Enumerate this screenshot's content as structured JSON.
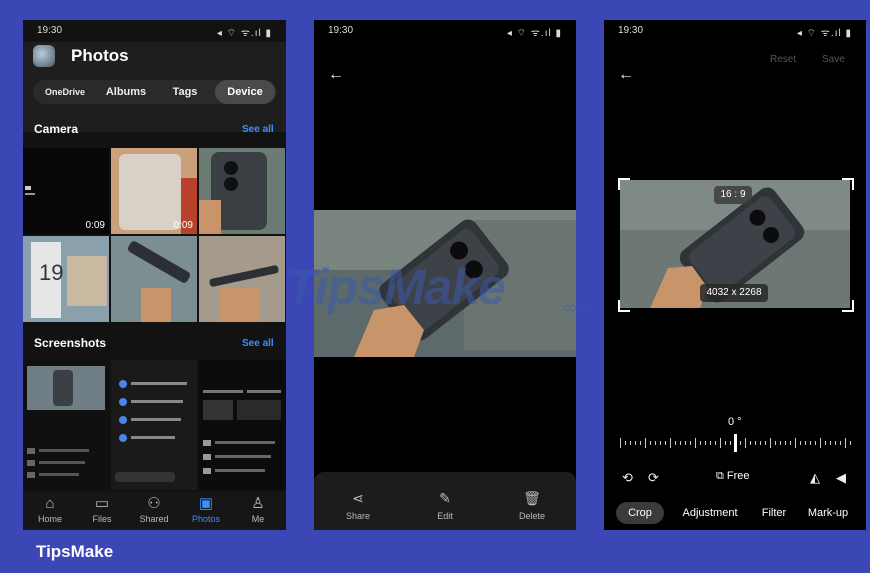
{
  "footer_brand": "TipsMake",
  "watermark": {
    "main": "TipsMake",
    "sub": ".com"
  },
  "phone1": {
    "status": {
      "time": "19:30",
      "icons": "◂ ⌔ ᯤ.ıl ▮"
    },
    "app_title": "Photos",
    "tabs": [
      {
        "label": "OneDrive"
      },
      {
        "label": "Albums"
      },
      {
        "label": "Tags"
      },
      {
        "label": "Device"
      }
    ],
    "camera_title": "Camera",
    "camera_see_all": "See all",
    "durations": [
      "0:09",
      "0:09"
    ],
    "screenshots_title": "Screenshots",
    "screenshots_see_all": "See all",
    "nav": [
      {
        "label": "Home",
        "icon": "home-icon"
      },
      {
        "label": "Files",
        "icon": "folder-icon"
      },
      {
        "label": "Shared",
        "icon": "people-icon"
      },
      {
        "label": "Photos",
        "icon": "photos-icon"
      },
      {
        "label": "Me",
        "icon": "person-icon"
      }
    ]
  },
  "phone2": {
    "status": {
      "time": "19:30",
      "icons": "◂ ⌔ ᯤ.ıl ▮"
    },
    "bottom_bar": [
      {
        "label": "Share",
        "icon": "share-icon"
      },
      {
        "label": "Edit",
        "icon": "edit-icon"
      },
      {
        "label": "Delete",
        "icon": "trash-icon"
      }
    ]
  },
  "phone3": {
    "status": {
      "time": "19:30",
      "icons": "◂ ⌔ ᯤ.ıl ▮"
    },
    "reset_label": "Reset",
    "save_label": "Save",
    "aspect_ratio": "16 : 9",
    "dimensions": "4032 x 2268",
    "rotation_degree": "0 °",
    "free_label": "Free",
    "modes": [
      {
        "label": "Crop"
      },
      {
        "label": "Adjustment"
      },
      {
        "label": "Filter"
      },
      {
        "label": "Mark-up"
      }
    ]
  }
}
